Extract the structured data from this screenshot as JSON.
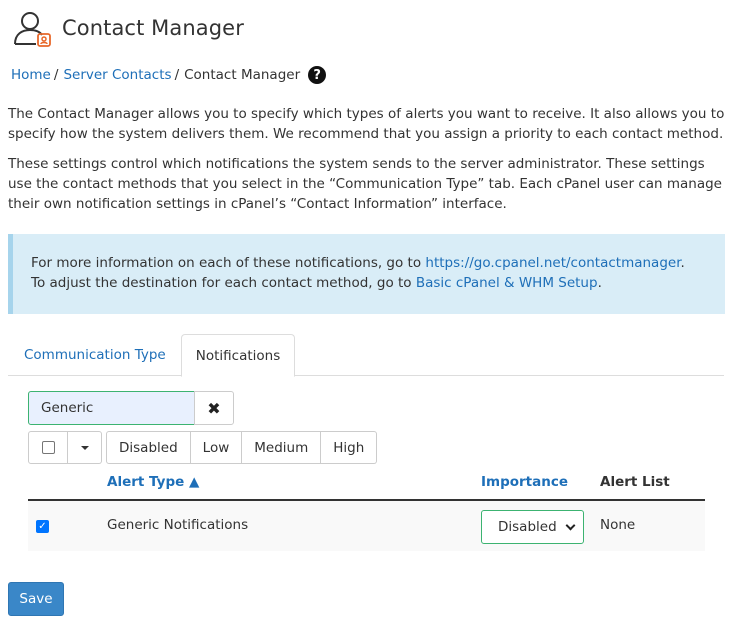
{
  "header": {
    "title": "Contact Manager",
    "icon": "contact-manager-icon"
  },
  "breadcrumb": {
    "home": "Home",
    "sep": "/",
    "server_contacts": "Server Contacts",
    "current": "Contact Manager",
    "help": "?"
  },
  "description": {
    "p1": "The Contact Manager allows you to specify which types of alerts you want to receive. It also allows you to specify how the system delivers them. We recommend that you assign a priority to each contact method.",
    "p2": "These settings control which notifications the system sends to the server administrator. These settings use the contact methods that you select in the “Communication Type” tab. Each cPanel user can manage their own notification settings in cPanel’s “Contact Information” interface."
  },
  "info": {
    "line1_prefix": "For more information on each of these notifications, go to ",
    "line1_link": "https://go.cpanel.net/contactmanager",
    "line1_suffix": ".",
    "line2_prefix": "To adjust the destination for each contact method, go to ",
    "line2_link": "Basic cPanel & WHM Setup",
    "line2_suffix": "."
  },
  "tabs": {
    "communication_type": "Communication Type",
    "notifications": "Notifications"
  },
  "filter": {
    "value": "Generic",
    "clear": "✖"
  },
  "toolbar": {
    "levels": [
      "Disabled",
      "Low",
      "Medium",
      "High"
    ]
  },
  "table": {
    "col_alert_type": "Alert Type ▲",
    "col_importance": "Importance",
    "col_alert_list": "Alert List",
    "rows": [
      {
        "checked": true,
        "name": "Generic Notifications",
        "importance": "Disabled",
        "alert_list": "None"
      }
    ]
  },
  "save_label": "Save",
  "colors": {
    "link": "#1e6fb8",
    "info_bg": "#d9edf7",
    "primary": "#3a87c8",
    "focus": "#3cb371"
  }
}
